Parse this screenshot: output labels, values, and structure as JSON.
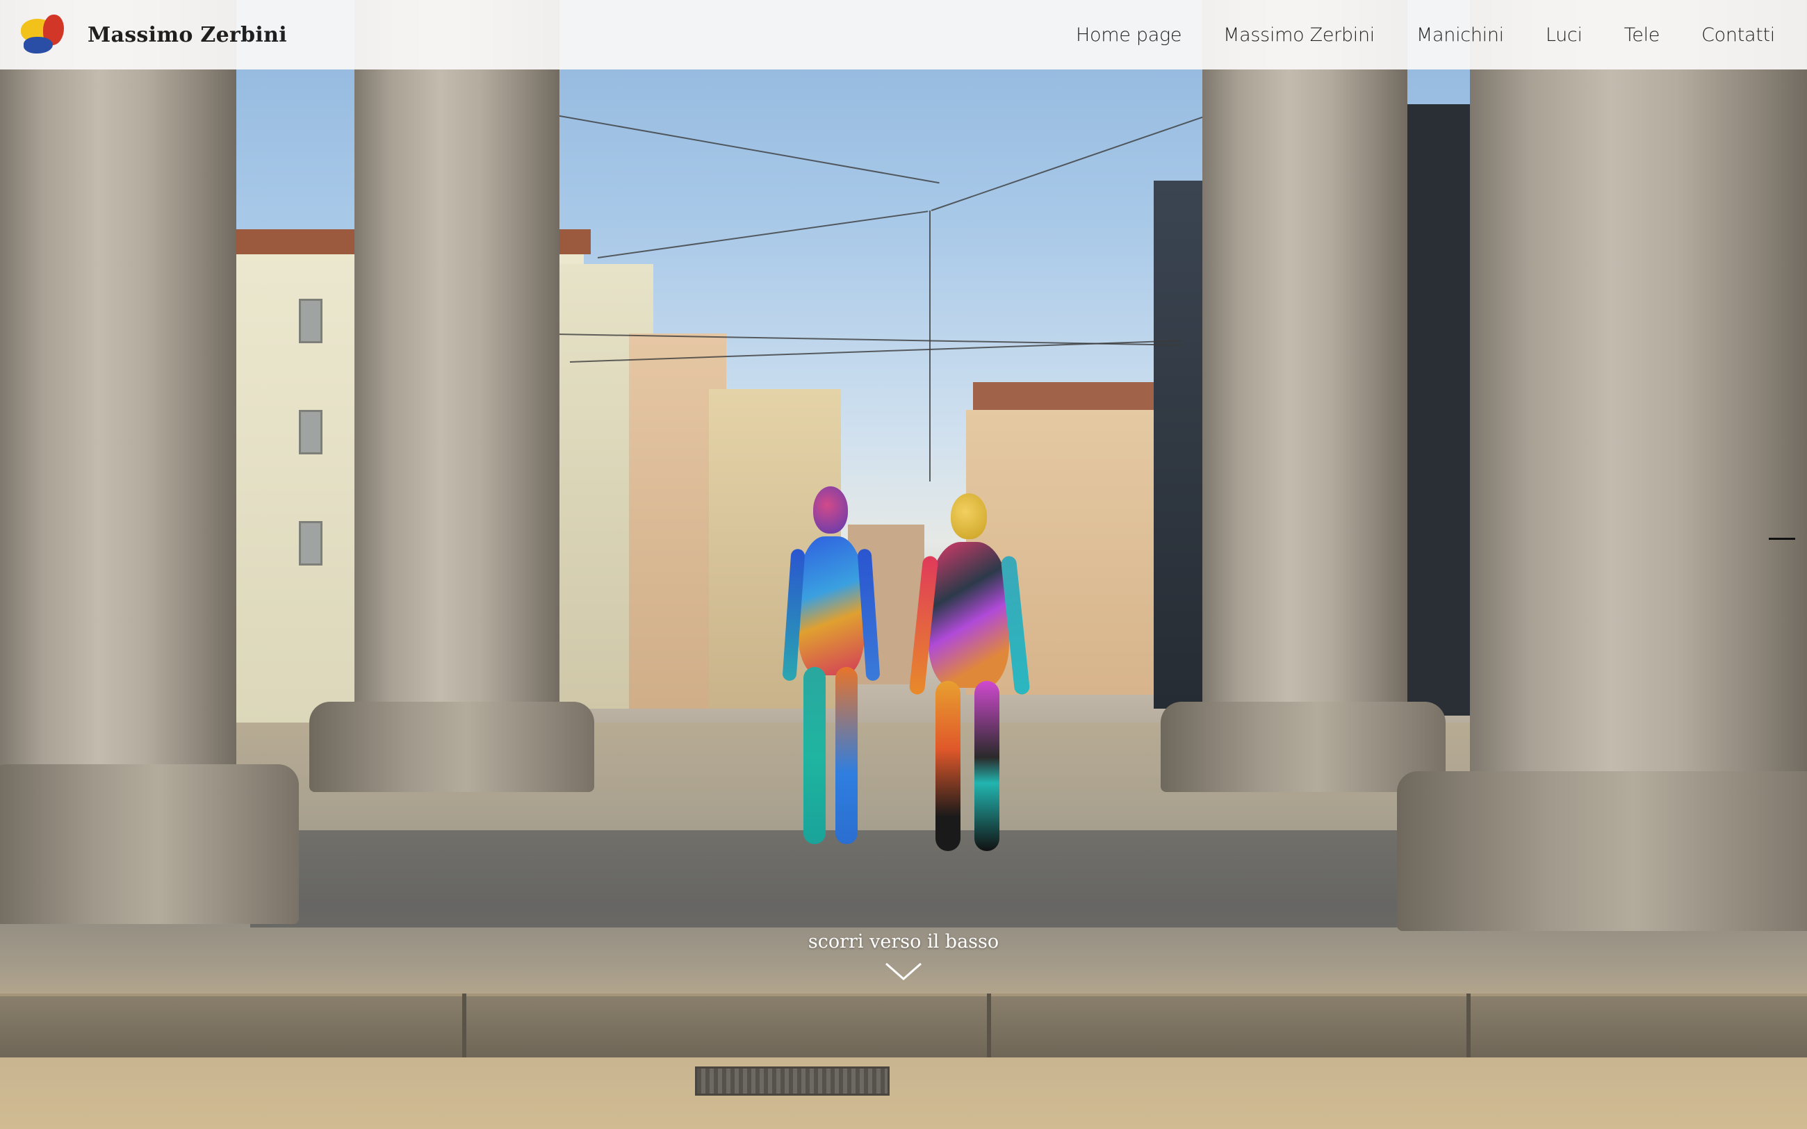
{
  "header": {
    "site_title": "Massimo Zerbini",
    "logo_icon": "palette-logo-icon",
    "logo_colors": [
      "#f2c21b",
      "#d23627",
      "#2a4ea6"
    ]
  },
  "nav": {
    "items": [
      {
        "label": "Home page"
      },
      {
        "label": "Massimo Zerbini"
      },
      {
        "label": "Manichini"
      },
      {
        "label": "Luci"
      },
      {
        "label": "Tele"
      },
      {
        "label": "Contatti"
      }
    ]
  },
  "hero": {
    "scroll_hint": "scorri verso il basso",
    "scroll_icon": "chevron-down-icon"
  }
}
